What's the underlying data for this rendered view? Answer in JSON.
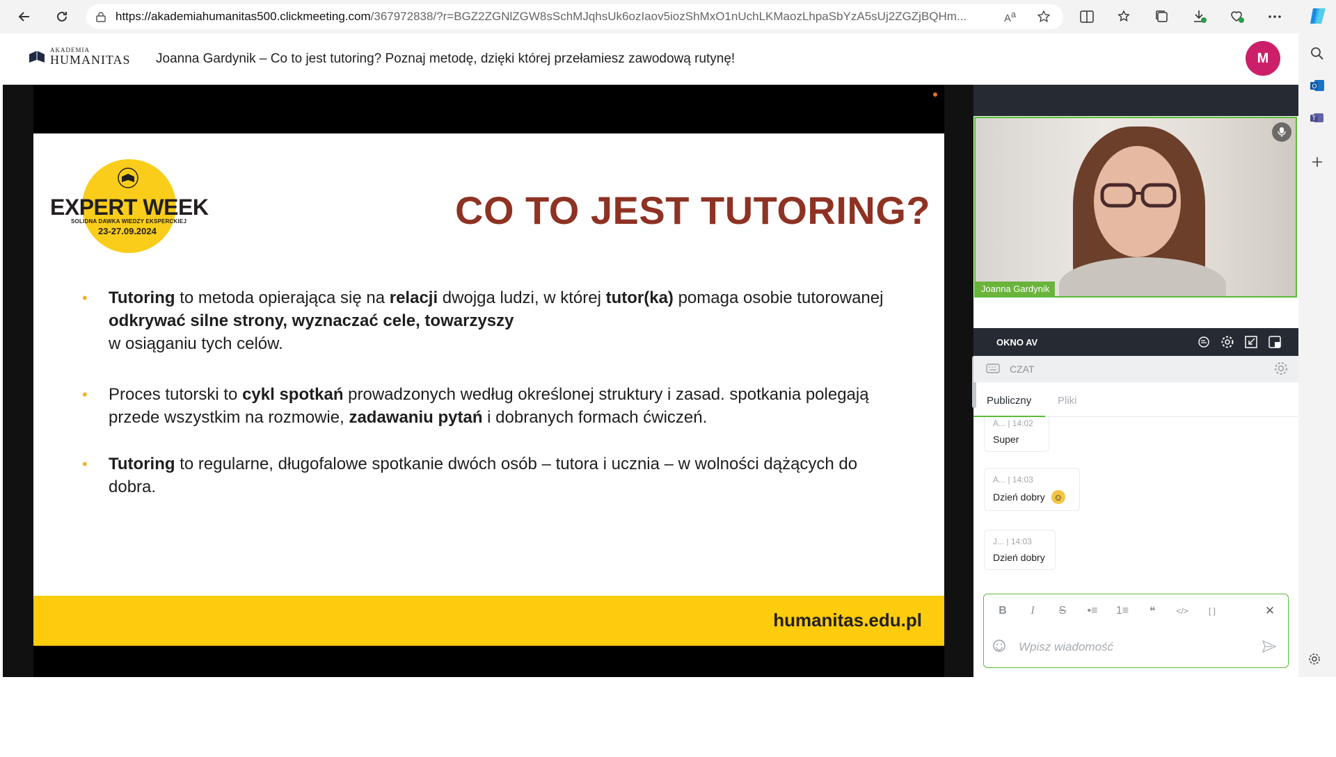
{
  "browser": {
    "url_host": "https://akademiahumanitas500.clickmeeting.com",
    "url_rest": "/367972838/?r=BGZ2ZGNlZGW8sSchMJqhsUk6ozIaov5iozShMxO1nUchLKMaozLhpaSbYzA5sUj2ZGZjBQHm..."
  },
  "header": {
    "logo_small": "AKADEMIA",
    "logo_big": "HUMANITAS",
    "title": "Joanna Gardynik – Co to jest tutoring? Poznaj metodę, dzięki której przełamiesz zawodową rutynę!",
    "avatar_initial": "M"
  },
  "slide": {
    "badge_title": "EXPERT WEEK",
    "badge_sub": "SOLIDNA DAWKA WIEDZY EKSPERCKIEJ",
    "badge_date": "23-27.09.2024",
    "heading": "CO TO JEST TUTORING?",
    "bullets": [
      [
        {
          "t": "Tutoring",
          "b": true
        },
        {
          "t": " to metoda opierająca się na ",
          "b": false
        },
        {
          "t": "relacji",
          "b": true
        },
        {
          "t": " dwojga ludzi, w której ",
          "b": false
        },
        {
          "t": "tutor(ka)",
          "b": true
        },
        {
          "t": " pomaga osobie tutorowanej ",
          "b": false
        },
        {
          "t": "odkrywać silne strony, wyznaczać cele, towarzyszy",
          "b": true
        },
        {
          "t": "\nw osiąganiu tych celów.",
          "b": false
        }
      ],
      [
        {
          "t": "Proces tutorski to ",
          "b": false
        },
        {
          "t": "cykl spotkań",
          "b": true
        },
        {
          "t": " prowadzonych według określonej struktury i zasad. spotkania polegają przede wszystkim na rozmowie, ",
          "b": false
        },
        {
          "t": "zadawaniu pytań",
          "b": true
        },
        {
          "t": " i dobranych formach ćwiczeń.",
          "b": false
        }
      ],
      [
        {
          "t": "Tutoring",
          "b": true
        },
        {
          "t": " to regularne, długofalowe spotkanie dwóch osób – tutora i ucznia – w wolności dążących do dobra.",
          "b": false
        }
      ]
    ],
    "footer_url": "humanitas.edu.pl"
  },
  "stage": {
    "speaker_caption": "Joanna Gardynik"
  },
  "video": {
    "participant_name": "Joanna Gardynik"
  },
  "av_window": {
    "label": "OKNO AV"
  },
  "chat": {
    "header_label": "CZAT",
    "tabs": [
      "Publiczny",
      "Pliki"
    ],
    "messages": [
      {
        "author": "A...",
        "time": "14:02",
        "text": "Super",
        "emoji": false
      },
      {
        "author": "A...",
        "time": "14:03",
        "text": "Dzień dobry",
        "emoji": true
      },
      {
        "author": "J...",
        "time": "14:03",
        "text": "Dzień dobry",
        "emoji": false
      }
    ],
    "input_placeholder": "Wpisz wiadomość",
    "format_buttons": [
      "B",
      "I",
      "S",
      "•≡",
      "1≡",
      "❝",
      "</>",
      "[ ]"
    ]
  },
  "colors": {
    "accent_green": "#5bbb3a",
    "avatar_pink": "#cc1f6a",
    "slide_yellow": "#fdcc0d",
    "slide_title_red": "#8e3223",
    "dark_bar": "#262b33"
  }
}
